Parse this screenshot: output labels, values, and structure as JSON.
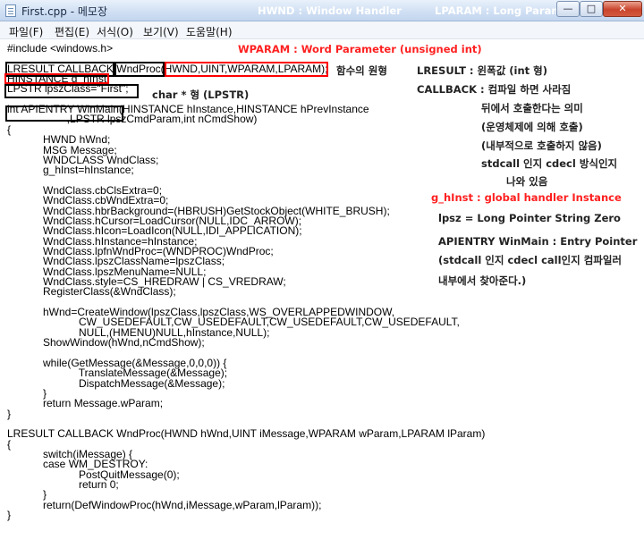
{
  "window": {
    "title": "First.cpp - 메모장",
    "min_glyph": "—",
    "max_glyph": "□",
    "close_glyph": "✕"
  },
  "menu": [
    {
      "label": "파일(F)"
    },
    {
      "label": "편집(E)"
    },
    {
      "label": "서식(O)"
    },
    {
      "label": "보기(V)"
    },
    {
      "label": "도움말(H)"
    }
  ],
  "titlebar_annotations": {
    "hwnd": "HWND : Window Handler",
    "lparam": "LPARAM : Long Parameter (int)"
  },
  "annotations": {
    "wparam": "WPARAM : Word Parameter (unsigned int)",
    "prototype": "함수의 원형",
    "lresult": "LRESULT : 윈폭값 (int 형)",
    "callback": "CALLBACK : 컴파일 하면 사라짐",
    "callback2": "뒤에서 호출한다는 의미",
    "callback3": "(운영체제에 의해 호출)",
    "callback4": "(내부적으로 호출하지 않음)",
    "callback5": "stdcall 인지 cdecl 방식인지",
    "callback6": "나와 있음",
    "ghinst": "g_hInst : global handler Instance",
    "lpsz": "lpsz = Long Pointer String Zero",
    "charptr": "char * 형 (LPSTR)",
    "apientry": "APIENTRY WinMain : Entry Pointer",
    "apientry2": "(stdcall 인지 cdecl call인지 컴파일러",
    "apientry3": "내부에서 찾아준다.)"
  },
  "code_lines": [
    "#include <windows.h>",
    "",
    "LRESULT CALLBACK WndProc(HWND,UINT,WPARAM,LPARAM);",
    "HINSTANCE g_hInst;",
    "LPSTR lpszClass=\"First\";",
    "",
    "int APIENTRY WinMain(HINSTANCE hInstance,HINSTANCE hPrevInstance",
    "                    ,LPSTR lpszCmdParam,int nCmdShow)",
    "{",
    "            HWND hWnd;",
    "            MSG Message;",
    "            WNDCLASS WndClass;",
    "            g_hInst=hInstance;",
    "",
    "            WndClass.cbClsExtra=0;",
    "            WndClass.cbWndExtra=0;",
    "            WndClass.hbrBackground=(HBRUSH)GetStockObject(WHITE_BRUSH);",
    "            WndClass.hCursor=LoadCursor(NULL,IDC_ARROW);",
    "            WndClass.hIcon=LoadIcon(NULL,IDI_APPLICATION);",
    "            WndClass.hInstance=hInstance;",
    "            WndClass.lpfnWndProc=(WNDPROC)WndProc;",
    "            WndClass.lpszClassName=lpszClass;",
    "            WndClass.lpszMenuName=NULL;",
    "            WndClass.style=CS_HREDRAW | CS_VREDRAW;",
    "            RegisterClass(&WndClass);",
    "",
    "            hWnd=CreateWindow(lpszClass,lpszClass,WS_OVERLAPPEDWINDOW,",
    "                        CW_USEDEFAULT,CW_USEDEFAULT,CW_USEDEFAULT,CW_USEDEFAULT,",
    "                        NULL,(HMENU)NULL,hInstance,NULL);",
    "            ShowWindow(hWnd,nCmdShow);",
    "",
    "            while(GetMessage(&Message,0,0,0)) {",
    "                        TranslateMessage(&Message);",
    "                        DispatchMessage(&Message);",
    "            }",
    "            return Message.wParam;",
    "}",
    "",
    "LRESULT CALLBACK WndProc(HWND hWnd,UINT iMessage,WPARAM wParam,LPARAM lParam)",
    "{",
    "            switch(iMessage) {",
    "            case WM_DESTROY:",
    "                        PostQuitMessage(0);",
    "                        return 0;",
    "            }",
    "            return(DefWindowProc(hWnd,iMessage,wParam,lParam));",
    "}"
  ]
}
